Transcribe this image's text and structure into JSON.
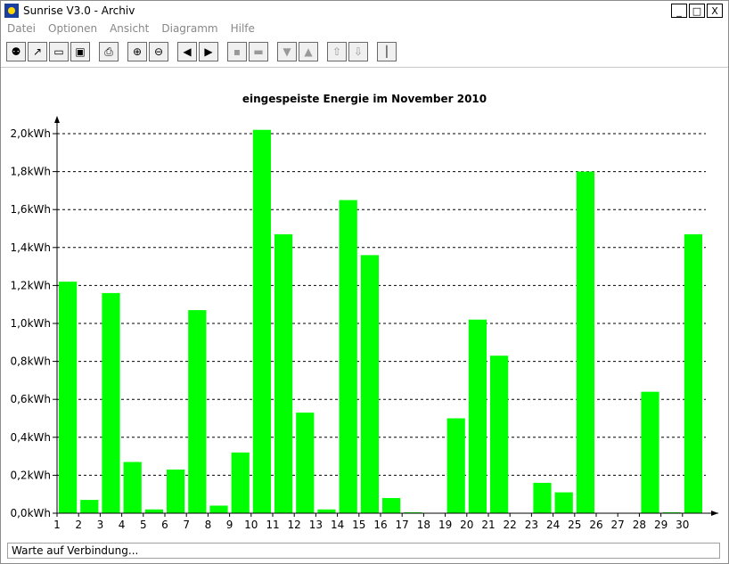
{
  "window": {
    "title": "Sunrise V3.0 - Archiv",
    "minimize": "_",
    "maximize": "□",
    "close": "X"
  },
  "menu": [
    "Datei",
    "Optionen",
    "Ansicht",
    "Diagramm",
    "Hilfe"
  ],
  "toolbar": {
    "icons": [
      "plug-icon",
      "chart-icon",
      "page-icon",
      "windows-icon",
      "print-icon",
      "zoom-in-icon",
      "zoom-out-icon",
      "prev-icon",
      "next-icon",
      "pin-icon",
      "folder-icon",
      "download-icon",
      "upload-icon",
      "import-icon",
      "export-icon",
      "thermometer-icon"
    ]
  },
  "status": {
    "text": "Warte auf Verbindung..."
  },
  "chart_data": {
    "type": "bar",
    "title": "eingespeiste Energie im November 2010",
    "xlabel": "",
    "ylabel": "",
    "ylim": [
      0,
      2.0
    ],
    "yticks": [
      "0,0kWh",
      "0,2kWh",
      "0,4kWh",
      "0,6kWh",
      "0,8kWh",
      "1,0kWh",
      "1,2kWh",
      "1,4kWh",
      "1,6kWh",
      "1,8kWh",
      "2,0kWh"
    ],
    "categories": [
      "1",
      "2",
      "3",
      "4",
      "5",
      "6",
      "7",
      "8",
      "9",
      "10",
      "11",
      "12",
      "13",
      "14",
      "15",
      "16",
      "17",
      "18",
      "19",
      "20",
      "21",
      "22",
      "23",
      "24",
      "25",
      "26",
      "27",
      "28",
      "29",
      "30"
    ],
    "values": [
      1.22,
      0.07,
      1.16,
      0.27,
      0.02,
      0.23,
      1.07,
      0.04,
      0.32,
      2.02,
      1.47,
      0.53,
      0.02,
      1.65,
      1.36,
      0.08,
      0.005,
      0.0,
      0.5,
      1.02,
      0.83,
      0.0,
      0.16,
      0.11,
      1.8,
      0.0,
      0.0,
      0.64,
      0.005,
      1.47
    ],
    "bar_color": "#00ff00",
    "grid": true
  }
}
